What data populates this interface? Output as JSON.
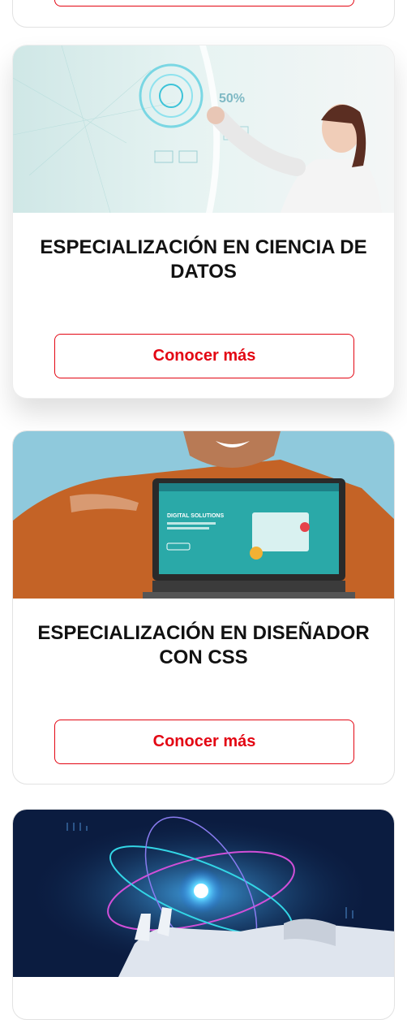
{
  "cards": [
    {
      "cta_label": ""
    },
    {
      "title": "ESPECIALIZACIÓN EN CIENCIA DE DATOS",
      "cta_label": "Conocer más"
    },
    {
      "title": "ESPECIALIZACIÓN EN DISEÑADOR CON CSS",
      "cta_label": "Conocer más"
    },
    {}
  ],
  "images": {
    "card1": {
      "hud_readout": "50%"
    },
    "card2": {
      "screen_heading": "DIGITAL SOLUTIONS"
    }
  },
  "colors": {
    "accent": "#e30613",
    "title": "#111111",
    "border": "#e2e2e2"
  }
}
